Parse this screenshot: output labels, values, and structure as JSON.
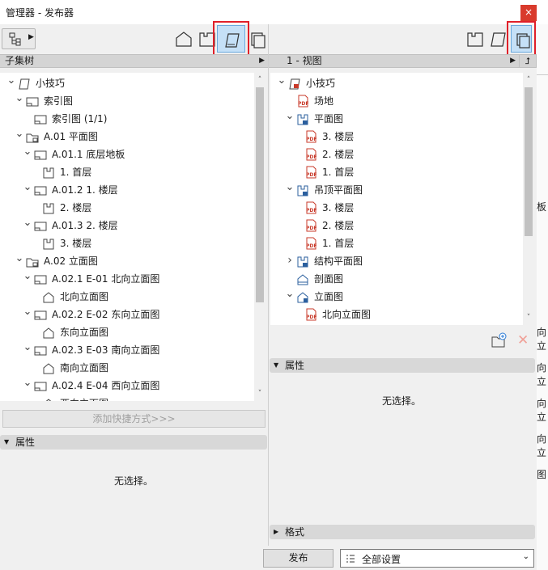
{
  "window": {
    "title": "管理器 - 发布器",
    "close_glyph": "×"
  },
  "left": {
    "header": "子集树",
    "tree": [
      {
        "label": "小技巧",
        "icon": "project-book-icon",
        "expand": "v"
      },
      {
        "label": "索引图",
        "icon": "layout-icon",
        "expand": "v"
      },
      {
        "label": "索引图 (1/1)",
        "icon": "layout-icon",
        "expand": ""
      },
      {
        "label": "A.01 平面图",
        "icon": "subset-folder-icon",
        "expand": "v"
      },
      {
        "label": "A.01.1 底层地板",
        "icon": "layout-icon",
        "expand": "v"
      },
      {
        "label": "1. 首层",
        "icon": "floorplan-icon",
        "expand": ""
      },
      {
        "label": "A.01.2 1. 楼层",
        "icon": "layout-icon",
        "expand": "v"
      },
      {
        "label": "2. 楼层",
        "icon": "floorplan-icon",
        "expand": ""
      },
      {
        "label": "A.01.3 2. 楼层",
        "icon": "layout-icon",
        "expand": "v"
      },
      {
        "label": "3. 楼层",
        "icon": "floorplan-icon",
        "expand": ""
      },
      {
        "label": "A.02 立面图",
        "icon": "subset-folder-icon",
        "expand": "v"
      },
      {
        "label": "A.02.1 E-01 北向立面图",
        "icon": "layout-icon",
        "expand": "v"
      },
      {
        "label": "北向立面图",
        "icon": "elevation-icon",
        "expand": ""
      },
      {
        "label": "A.02.2 E-02 东向立面图",
        "icon": "layout-icon",
        "expand": "v"
      },
      {
        "label": "东向立面图",
        "icon": "elevation-icon",
        "expand": ""
      },
      {
        "label": "A.02.3 E-03 南向立面图",
        "icon": "layout-icon",
        "expand": "v"
      },
      {
        "label": "南向立面图",
        "icon": "elevation-icon",
        "expand": ""
      },
      {
        "label": "A.02.4 E-04 西向立面图",
        "icon": "layout-icon",
        "expand": "v"
      },
      {
        "label": "西向立面图",
        "icon": "elevation-icon",
        "expand": ""
      }
    ],
    "add_shortcut_button": "添加快捷方式>>>",
    "properties_label": "属性",
    "no_selection": "无选择。"
  },
  "right": {
    "header": "1 - 视图",
    "tree": [
      {
        "label": "小技巧",
        "icon": "publisher-set-icon",
        "expand": "v"
      },
      {
        "label": "场地",
        "icon": "pdf-icon",
        "expand": ""
      },
      {
        "label": "平面图",
        "icon": "pdf-folder-icon",
        "expand": "v"
      },
      {
        "label": "3. 楼层",
        "icon": "pdf-icon",
        "expand": ""
      },
      {
        "label": "2. 楼层",
        "icon": "pdf-icon",
        "expand": ""
      },
      {
        "label": "1. 首层",
        "icon": "pdf-icon",
        "expand": ""
      },
      {
        "label": "吊顶平面图",
        "icon": "pdf-folder-icon",
        "expand": "v"
      },
      {
        "label": "3. 楼层",
        "icon": "pdf-icon",
        "expand": ""
      },
      {
        "label": "2. 楼层",
        "icon": "pdf-icon",
        "expand": ""
      },
      {
        "label": "1. 首层",
        "icon": "pdf-icon",
        "expand": ""
      },
      {
        "label": "结构平面图",
        "icon": "pdf-folder-icon",
        "expand": ">"
      },
      {
        "label": "剖面图",
        "icon": "section-icon",
        "expand": ""
      },
      {
        "label": "立面图",
        "icon": "elevation-folder-icon",
        "expand": "v"
      },
      {
        "label": "北向立面图",
        "icon": "pdf-icon",
        "expand": ""
      }
    ],
    "properties_label": "属性",
    "no_selection": "无选择。",
    "format_label": "格式"
  },
  "bottom": {
    "publish_button": "发布",
    "settings_select": "全部设置"
  },
  "behind_window_fragments": [
    "板",
    "向立",
    "向立",
    "向立",
    "向立",
    "图"
  ],
  "colors": {
    "highlight_border": "#e0202a",
    "pdf_red": "#c83a2a",
    "selected_tool": "#c5e0f7"
  }
}
